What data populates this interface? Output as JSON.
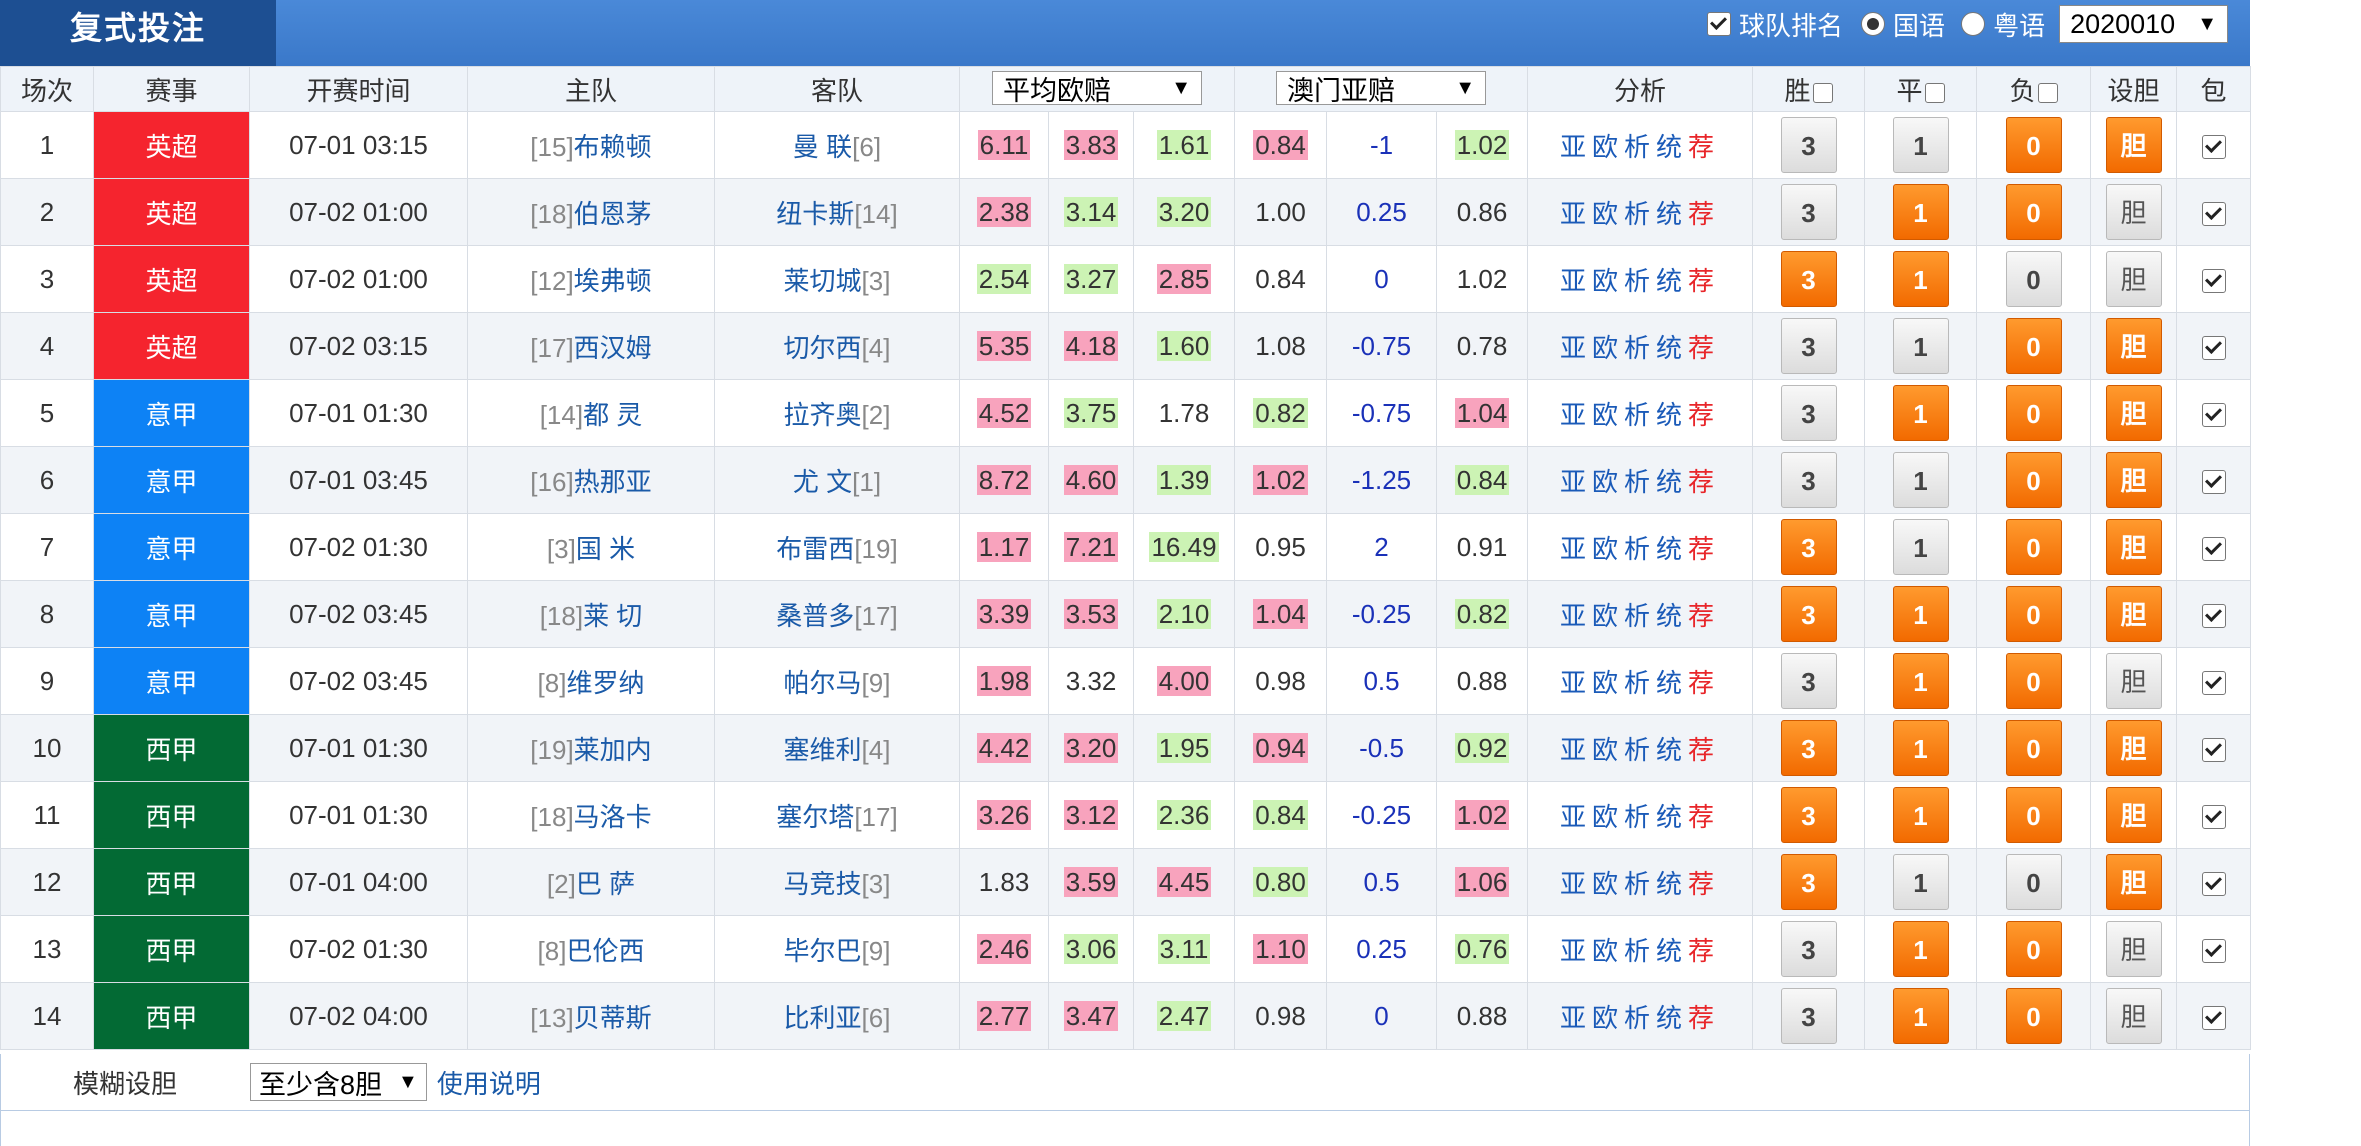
{
  "header": {
    "title": "复式投注",
    "team_rank_label": "球队排名",
    "team_rank_checked": true,
    "lang_options": [
      "国语",
      "粤语"
    ],
    "lang_selected": "国语",
    "season": "2020010"
  },
  "columns": {
    "no": "场次",
    "league": "赛事",
    "time": "开赛时间",
    "home": "主队",
    "away": "客队",
    "odds_select": "平均欧赔",
    "asian_select": "澳门亚赔",
    "analysis": "分析",
    "win": "胜",
    "draw": "平",
    "lose": "负",
    "banker": "设胆",
    "include": "包"
  },
  "analysis_links": [
    "亚",
    "欧",
    "析",
    "统",
    "荐"
  ],
  "banker_label": "胆",
  "league_colors": {
    "英超": "#f5242e",
    "意甲": "#0d82f5",
    "西甲": "#036a34"
  },
  "matches": [
    {
      "no": "1",
      "league": "英超",
      "time": "07-01 03:15",
      "home_rank": "[15]",
      "home": "布赖顿",
      "away": "曼 联",
      "away_rank": "[6]",
      "o1": "6.11",
      "o2": "3.83",
      "o3": "1.61",
      "h1": "0.84",
      "h2": "-1",
      "h3": "1.02",
      "oc": [
        "r",
        "r",
        "g"
      ],
      "hc": [
        "r",
        "",
        "g"
      ],
      "win": "3",
      "draw": "1",
      "lose": "0",
      "sel": [
        false,
        false,
        true
      ],
      "banker": true,
      "include": true
    },
    {
      "no": "2",
      "league": "英超",
      "time": "07-02 01:00",
      "home_rank": "[18]",
      "home": "伯恩茅",
      "away": "纽卡斯",
      "away_rank": "[14]",
      "o1": "2.38",
      "o2": "3.14",
      "o3": "3.20",
      "h1": "1.00",
      "h2": "0.25",
      "h3": "0.86",
      "oc": [
        "r",
        "g",
        "g"
      ],
      "hc": [
        "",
        "",
        ""
      ],
      "win": "3",
      "draw": "1",
      "lose": "0",
      "sel": [
        false,
        true,
        true
      ],
      "banker": false,
      "include": true
    },
    {
      "no": "3",
      "league": "英超",
      "time": "07-02 01:00",
      "home_rank": "[12]",
      "home": "埃弗顿",
      "away": "莱切城",
      "away_rank": "[3]",
      "o1": "2.54",
      "o2": "3.27",
      "o3": "2.85",
      "h1": "0.84",
      "h2": "0",
      "h3": "1.02",
      "oc": [
        "g",
        "g",
        "r"
      ],
      "hc": [
        "",
        "",
        ""
      ],
      "win": "3",
      "draw": "1",
      "lose": "0",
      "sel": [
        true,
        true,
        false
      ],
      "banker": false,
      "include": true
    },
    {
      "no": "4",
      "league": "英超",
      "time": "07-02 03:15",
      "home_rank": "[17]",
      "home": "西汉姆",
      "away": "切尔西",
      "away_rank": "[4]",
      "o1": "5.35",
      "o2": "4.18",
      "o3": "1.60",
      "h1": "1.08",
      "h2": "-0.75",
      "h3": "0.78",
      "oc": [
        "r",
        "r",
        "g"
      ],
      "hc": [
        "",
        "",
        ""
      ],
      "win": "3",
      "draw": "1",
      "lose": "0",
      "sel": [
        false,
        false,
        true
      ],
      "banker": true,
      "include": true
    },
    {
      "no": "5",
      "league": "意甲",
      "time": "07-01 01:30",
      "home_rank": "[14]",
      "home": "都 灵",
      "away": "拉齐奥",
      "away_rank": "[2]",
      "o1": "4.52",
      "o2": "3.75",
      "o3": "1.78",
      "h1": "0.82",
      "h2": "-0.75",
      "h3": "1.04",
      "oc": [
        "r",
        "g",
        ""
      ],
      "hc": [
        "g",
        "",
        "r"
      ],
      "win": "3",
      "draw": "1",
      "lose": "0",
      "sel": [
        false,
        true,
        true
      ],
      "banker": true,
      "include": true
    },
    {
      "no": "6",
      "league": "意甲",
      "time": "07-01 03:45",
      "home_rank": "[16]",
      "home": "热那亚",
      "away": "尤 文",
      "away_rank": "[1]",
      "o1": "8.72",
      "o2": "4.60",
      "o3": "1.39",
      "h1": "1.02",
      "h2": "-1.25",
      "h3": "0.84",
      "oc": [
        "r",
        "r",
        "g"
      ],
      "hc": [
        "r",
        "",
        "g"
      ],
      "win": "3",
      "draw": "1",
      "lose": "0",
      "sel": [
        false,
        false,
        true
      ],
      "banker": true,
      "include": true
    },
    {
      "no": "7",
      "league": "意甲",
      "time": "07-02 01:30",
      "home_rank": "[3]",
      "home": "国 米",
      "away": "布雷西",
      "away_rank": "[19]",
      "o1": "1.17",
      "o2": "7.21",
      "o3": "16.49",
      "h1": "0.95",
      "h2": "2",
      "h3": "0.91",
      "oc": [
        "r",
        "r",
        "g"
      ],
      "hc": [
        "",
        "",
        ""
      ],
      "win": "3",
      "draw": "1",
      "lose": "0",
      "sel": [
        true,
        false,
        true
      ],
      "banker": true,
      "include": true
    },
    {
      "no": "8",
      "league": "意甲",
      "time": "07-02 03:45",
      "home_rank": "[18]",
      "home": "莱 切",
      "away": "桑普多",
      "away_rank": "[17]",
      "o1": "3.39",
      "o2": "3.53",
      "o3": "2.10",
      "h1": "1.04",
      "h2": "-0.25",
      "h3": "0.82",
      "oc": [
        "r",
        "r",
        "g"
      ],
      "hc": [
        "r",
        "",
        "g"
      ],
      "win": "3",
      "draw": "1",
      "lose": "0",
      "sel": [
        true,
        true,
        true
      ],
      "banker": true,
      "include": true
    },
    {
      "no": "9",
      "league": "意甲",
      "time": "07-02 03:45",
      "home_rank": "[8]",
      "home": "维罗纳",
      "away": "帕尔马",
      "away_rank": "[9]",
      "o1": "1.98",
      "o2": "3.32",
      "o3": "4.00",
      "h1": "0.98",
      "h2": "0.5",
      "h3": "0.88",
      "oc": [
        "r",
        "",
        "r"
      ],
      "hc": [
        "",
        "",
        ""
      ],
      "win": "3",
      "draw": "1",
      "lose": "0",
      "sel": [
        false,
        true,
        true
      ],
      "banker": false,
      "include": true
    },
    {
      "no": "10",
      "league": "西甲",
      "time": "07-01 01:30",
      "home_rank": "[19]",
      "home": "莱加内",
      "away": "塞维利",
      "away_rank": "[4]",
      "o1": "4.42",
      "o2": "3.20",
      "o3": "1.95",
      "h1": "0.94",
      "h2": "-0.5",
      "h3": "0.92",
      "oc": [
        "r",
        "r",
        "g"
      ],
      "hc": [
        "r",
        "",
        "g"
      ],
      "win": "3",
      "draw": "1",
      "lose": "0",
      "sel": [
        true,
        true,
        true
      ],
      "banker": true,
      "include": true
    },
    {
      "no": "11",
      "league": "西甲",
      "time": "07-01 01:30",
      "home_rank": "[18]",
      "home": "马洛卡",
      "away": "塞尔塔",
      "away_rank": "[17]",
      "o1": "3.26",
      "o2": "3.12",
      "o3": "2.36",
      "h1": "0.84",
      "h2": "-0.25",
      "h3": "1.02",
      "oc": [
        "r",
        "r",
        "g"
      ],
      "hc": [
        "g",
        "",
        "r"
      ],
      "win": "3",
      "draw": "1",
      "lose": "0",
      "sel": [
        true,
        true,
        true
      ],
      "banker": true,
      "include": true
    },
    {
      "no": "12",
      "league": "西甲",
      "time": "07-01 04:00",
      "home_rank": "[2]",
      "home": "巴 萨",
      "away": "马竞技",
      "away_rank": "[3]",
      "o1": "1.83",
      "o2": "3.59",
      "o3": "4.45",
      "h1": "0.80",
      "h2": "0.5",
      "h3": "1.06",
      "oc": [
        "",
        "r",
        "r"
      ],
      "hc": [
        "g",
        "",
        "r"
      ],
      "win": "3",
      "draw": "1",
      "lose": "0",
      "sel": [
        true,
        false,
        false
      ],
      "banker": true,
      "include": true
    },
    {
      "no": "13",
      "league": "西甲",
      "time": "07-02 01:30",
      "home_rank": "[8]",
      "home": "巴伦西",
      "away": "毕尔巴",
      "away_rank": "[9]",
      "o1": "2.46",
      "o2": "3.06",
      "o3": "3.11",
      "h1": "1.10",
      "h2": "0.25",
      "h3": "0.76",
      "oc": [
        "r",
        "g",
        "g"
      ],
      "hc": [
        "r",
        "",
        "g"
      ],
      "win": "3",
      "draw": "1",
      "lose": "0",
      "sel": [
        false,
        true,
        true
      ],
      "banker": false,
      "include": true
    },
    {
      "no": "14",
      "league": "西甲",
      "time": "07-02 04:00",
      "home_rank": "[13]",
      "home": "贝蒂斯",
      "away": "比利亚",
      "away_rank": "[6]",
      "o1": "2.77",
      "o2": "3.47",
      "o3": "2.47",
      "h1": "0.98",
      "h2": "0",
      "h3": "0.88",
      "oc": [
        "r",
        "r",
        "g"
      ],
      "hc": [
        "",
        "",
        ""
      ],
      "win": "3",
      "draw": "1",
      "lose": "0",
      "sel": [
        false,
        true,
        true
      ],
      "banker": false,
      "include": true
    }
  ],
  "footer": {
    "fuzzy_label": "模糊设胆",
    "fuzzy_value": "至少含8胆",
    "help_link": "使用说明"
  }
}
